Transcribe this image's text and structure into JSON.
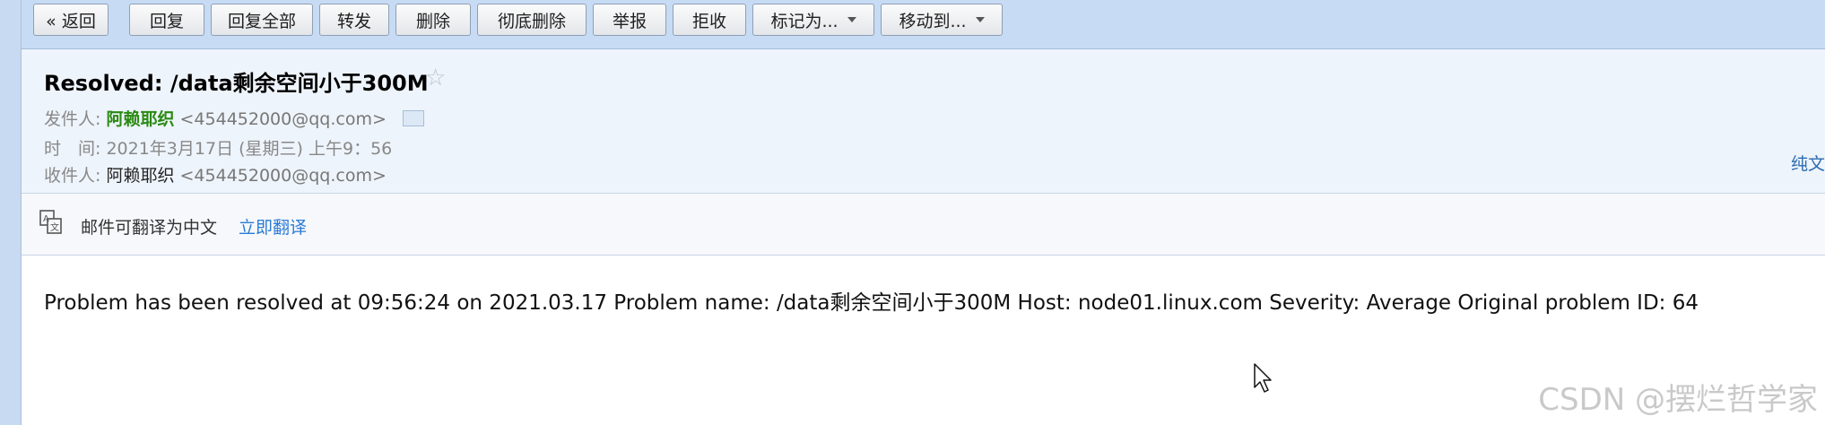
{
  "toolbar": {
    "back": "« 返回",
    "reply": "回复",
    "reply_all": "回复全部",
    "forward": "转发",
    "delete": "删除",
    "delete_permanently": "彻底删除",
    "report": "举报",
    "reject": "拒收",
    "mark_as": "标记为...",
    "move_to": "移动到..."
  },
  "mail": {
    "subject": "Resolved: /data剩余空间小于300M",
    "from_label": "发件人:",
    "from_name": "阿赖耶织",
    "from_addr": "<454452000@qq.com>",
    "time_label": "时　间:",
    "time_value": "2021年3月17日 (星期三) 上午9：56",
    "to_label": "收件人:",
    "to_name": "阿赖耶织",
    "to_addr": "<454452000@qq.com>",
    "plain_text_link": "纯文"
  },
  "translate": {
    "message": "邮件可翻译为中文",
    "action": "立即翻译"
  },
  "content": {
    "body": "Problem has been resolved at 09:56:24 on 2021.03.17 Problem name: /data剩余空间小于300M Host: node01.linux.com Severity: Average Original problem ID: 64"
  },
  "watermark": "CSDN @摆烂哲学家",
  "icons": [
    "star-icon",
    "contact-card-icon",
    "translate-icon",
    "mouse-cursor-icon"
  ],
  "colors": {
    "toolbar_bg": "#c7dbf4",
    "header_bg": "#eef4fb",
    "sender_name": "#2a8a12",
    "link": "#2b7bd6"
  }
}
